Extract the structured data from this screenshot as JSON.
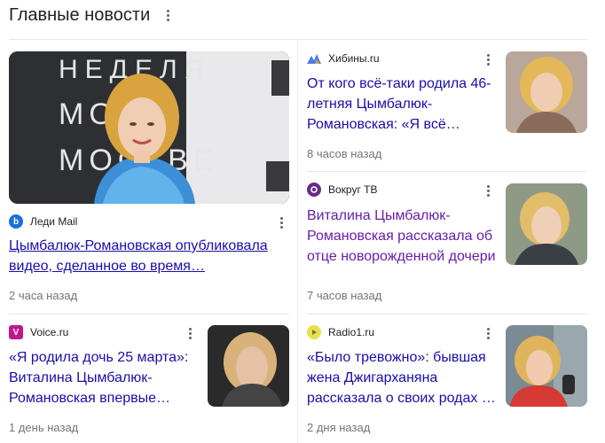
{
  "header": {
    "title": "Главные новости"
  },
  "featured": {
    "image_text": "НЕДЕЛЯ МОДЫ В МОСКВЕ",
    "source": "Леди Mail",
    "headline_line1": "Цымбалюк-Романовская опубликовала",
    "headline_line2": "видео, сделанное во время…",
    "time": "2 часа назад"
  },
  "stories": [
    {
      "source": "Хибины.ru",
      "line1": "От кого всё-таки родила 46-",
      "line2": "летняя Цымбалюк-",
      "line3": "Романовская: «Я всё…",
      "time": "8 часов назад"
    },
    {
      "source": "Вокруг ТВ",
      "line1": "Виталина Цымбалюк-",
      "line2": "Романовская рассказала об",
      "line3": "отце новорожденной дочери",
      "time": "7 часов назад"
    },
    {
      "source": "Voice.ru",
      "line1": "«Я родила дочь 25 марта»:",
      "line2": "Виталина Цымбалюк-",
      "line3": "Романовская впервые…",
      "time": "1 день назад"
    },
    {
      "source": "Radio1.ru",
      "line1": "«Было тревожно»: бывшая",
      "line2": "жена Джигарханяна",
      "line3": "рассказала о своих родах …",
      "time": "2 дня назад"
    }
  ],
  "colors": {
    "link": "#1a0dab",
    "visited": "#681da8",
    "meta": "#70757a"
  }
}
